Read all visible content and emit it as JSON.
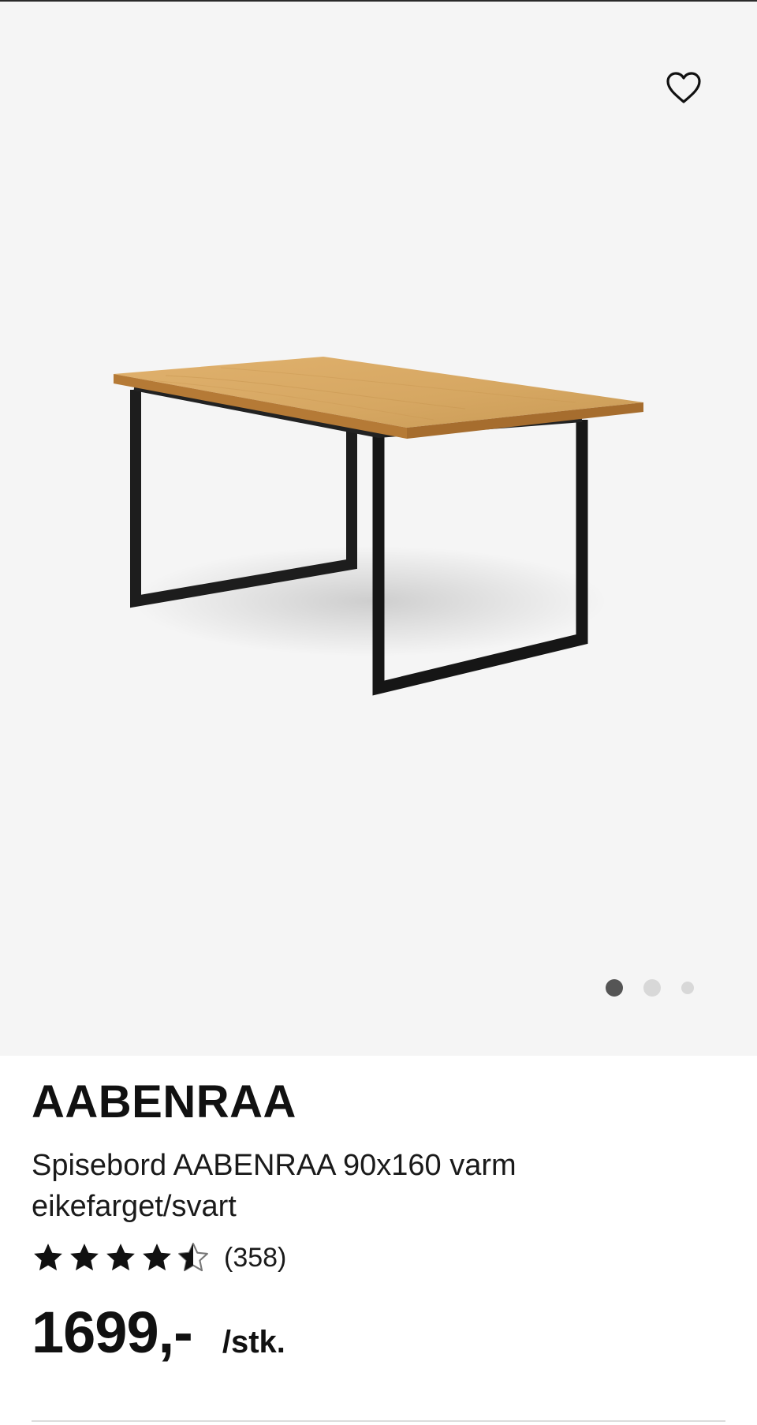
{
  "gallery": {
    "favorite_icon": "heart-outline-icon",
    "image_alt": "Spisebord AABENRAA 90x160 varm eikefarget/svart",
    "dots": {
      "count": 3,
      "active_index": 0,
      "active_color": "#555555",
      "inactive_color": "#d8d8d8"
    }
  },
  "product": {
    "brand": "AABENRAA",
    "description": "Spisebord AABENRAA 90x160 varm eikefarget/svart",
    "rating": {
      "value": 4.5,
      "max": 5,
      "count_text": "(358)"
    },
    "price": "1699,-",
    "unit": "/stk."
  },
  "colors": {
    "gallery_background": "#f5f5f5",
    "text": "#111111",
    "star": "#111111"
  }
}
